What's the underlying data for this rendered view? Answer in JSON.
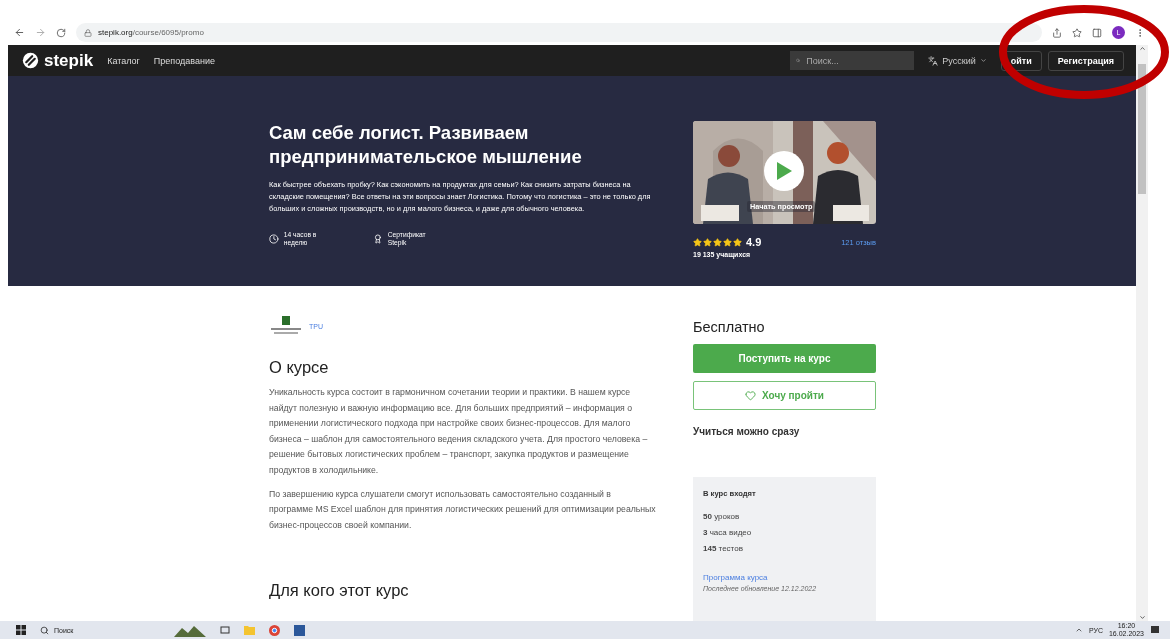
{
  "browser": {
    "url_host": "stepik.org",
    "url_path": "/course/6095/promo",
    "profile_initial": "L"
  },
  "header": {
    "logo": "stepik",
    "nav": [
      "Каталог",
      "Преподавание"
    ],
    "search": {
      "placeholder": "Поиск..."
    },
    "language": "Русский",
    "login": "ойти",
    "register": "Регистрация"
  },
  "hero": {
    "title": "Сам себе логист. Развиваем предпринимательское мышление",
    "description": "Как быстрее объехать пробку? Как сэкономить на продуктах для семьи? Как снизить затраты бизнеса на складские помещения? Все ответы на эти вопросы знает Логистика. Потому что логистика – это не только для больших и сложных производств, но и для малого бизнеса, и даже для обычного человека.",
    "features": [
      {
        "kind": "clock",
        "text": "14 часов в неделю"
      },
      {
        "kind": "certificate",
        "text": "Сертификат Stepik"
      }
    ],
    "video": {
      "kind": "picture",
      "label": "Начать просмотр"
    },
    "stars": 5,
    "rating": "4.9",
    "reviews": "121 отзыв",
    "learners": "19 135 учащихся"
  },
  "author": "TPU",
  "about": {
    "title": "О курсе",
    "paragraphs": [
      "Уникальность курса состоит в гармоничном сочетании теории и практики. В нашем курсе найдут полезную и важную информацию все. Для больших предприятий – информация о применении логистического подхода при настройке своих бизнес-процессов. Для малого бизнеса – шаблон для самостоятельного ведения складского учета. Для простого человека – решение бытовых логистических проблем – транспорт, закупка продуктов и размещение продуктов в холодильнике.",
      "По завершению курса слушатели смогут использовать самостоятельно созданный в программе MS Excel шаблон для принятия логистических решений для оптимизации реальных бизнес-процессов своей компании."
    ]
  },
  "next_section": "Для кого этот курс",
  "sidebar": {
    "price": "Бесплатно",
    "enroll": "Поступить на курс",
    "wishlist": "Хочу пройти",
    "start": "Учиться можно сразу",
    "includes": {
      "title": "В курс входят",
      "items": [
        "**50** уроков",
        "**3** часа видео",
        "**145** тестов"
      ],
      "program_link": "Программа курса",
      "updated": "Последнее обновление 12.12.2022"
    }
  },
  "taskbar": {
    "search": "Поиск",
    "language": "РУС",
    "time": "16:20",
    "date": "16.02.2023"
  }
}
